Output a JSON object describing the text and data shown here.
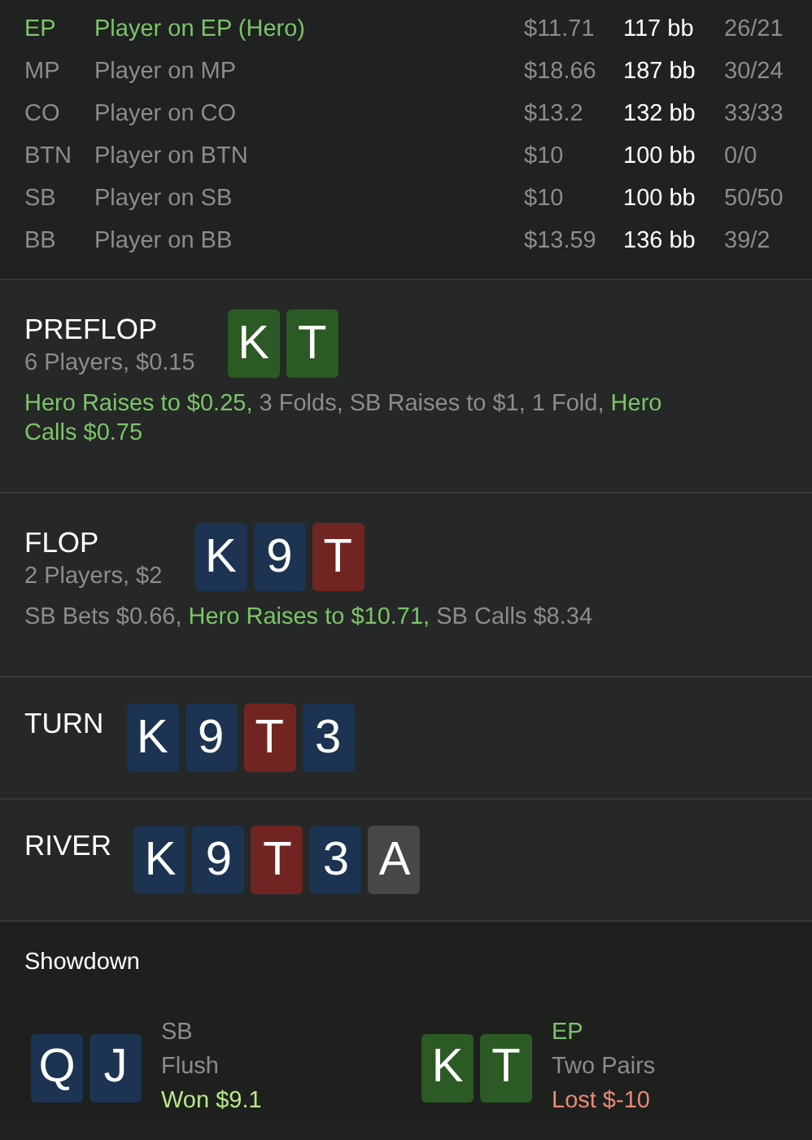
{
  "players": [
    {
      "position": "EP",
      "name": "Player on EP (Hero)",
      "hero": true,
      "stack": "$11.71",
      "bb": "117 bb",
      "stats": "26/21"
    },
    {
      "position": "MP",
      "name": "Player on MP",
      "hero": false,
      "stack": "$18.66",
      "bb": "187 bb",
      "stats": "30/24"
    },
    {
      "position": "CO",
      "name": "Player on CO",
      "hero": false,
      "stack": "$13.2",
      "bb": "132 bb",
      "stats": "33/33"
    },
    {
      "position": "BTN",
      "name": "Player on BTN",
      "hero": false,
      "stack": "$10",
      "bb": "100 bb",
      "stats": "0/0"
    },
    {
      "position": "SB",
      "name": "Player on SB",
      "hero": false,
      "stack": "$10",
      "bb": "100 bb",
      "stats": "50/50"
    },
    {
      "position": "BB",
      "name": "Player on BB",
      "hero": false,
      "stack": "$13.59",
      "bb": "136 bb",
      "stats": "39/2"
    }
  ],
  "streets": [
    {
      "title": "PREFLOP",
      "info": "6 Players, $0.15",
      "cards": [
        {
          "rank": "K",
          "color": "#2c5a24"
        },
        {
          "rank": "T",
          "color": "#2c5a24"
        }
      ],
      "actions": [
        {
          "text": "Hero Raises to $0.25,",
          "hero": true
        },
        {
          "text": "3 Folds, SB Raises to $1, 1 Fold,",
          "hero": false
        },
        {
          "text": "Hero Calls $0.75",
          "hero": true
        }
      ]
    },
    {
      "title": "FLOP",
      "info": "2 Players, $2",
      "cards": [
        {
          "rank": "K",
          "color": "#1c3352"
        },
        {
          "rank": "9",
          "color": "#1c3352"
        },
        {
          "rank": "T",
          "color": "#712522"
        }
      ],
      "actions": [
        {
          "text": "SB Bets $0.66,",
          "hero": false
        },
        {
          "text": "Hero Raises to $10.71,",
          "hero": true
        },
        {
          "text": "SB Calls $8.34",
          "hero": false
        }
      ]
    },
    {
      "title": "TURN",
      "cards": [
        {
          "rank": "K",
          "color": "#1c3352"
        },
        {
          "rank": "9",
          "color": "#1c3352"
        },
        {
          "rank": "T",
          "color": "#712522"
        },
        {
          "rank": "3",
          "color": "#1c3352"
        }
      ]
    },
    {
      "title": "RIVER",
      "cards": [
        {
          "rank": "K",
          "color": "#1c3352"
        },
        {
          "rank": "9",
          "color": "#1c3352"
        },
        {
          "rank": "T",
          "color": "#712522"
        },
        {
          "rank": "3",
          "color": "#1c3352"
        },
        {
          "rank": "A",
          "color": "#484848"
        }
      ]
    }
  ],
  "showdown": {
    "title": "Showdown",
    "hands": [
      {
        "cards": [
          {
            "rank": "Q",
            "color": "#1c3352"
          },
          {
            "rank": "J",
            "color": "#1c3352"
          }
        ],
        "position": "SB",
        "hero": false,
        "hand": "Flush",
        "result": "Won $9.1",
        "won": true
      },
      {
        "cards": [
          {
            "rank": "K",
            "color": "#2c5a24"
          },
          {
            "rank": "T",
            "color": "#2c5a24"
          }
        ],
        "position": "EP",
        "hero": true,
        "hand": "Two Pairs",
        "result": "Lost $-10",
        "won": false
      }
    ]
  }
}
